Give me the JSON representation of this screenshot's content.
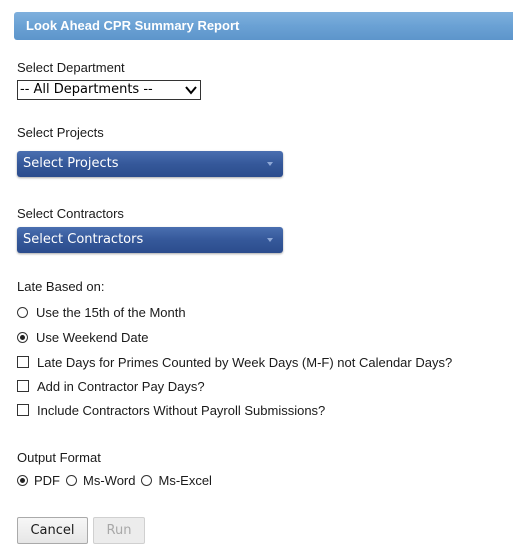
{
  "header": {
    "title": "Look Ahead CPR Summary Report"
  },
  "department": {
    "label": "Select Department",
    "selected": "-- All Departments --"
  },
  "projects": {
    "label": "Select Projects",
    "button_text": "Select Projects"
  },
  "contractors": {
    "label": "Select Contractors",
    "button_text": "Select Contractors"
  },
  "late_based": {
    "label": "Late Based on:",
    "options": [
      {
        "label": "Use the 15th of the Month",
        "selected": false
      },
      {
        "label": "Use Weekend Date",
        "selected": true
      }
    ]
  },
  "checkboxes": [
    {
      "label": "Late Days for Primes Counted by Week Days (M-F) not Calendar Days?",
      "checked": false
    },
    {
      "label": "Add in Contractor Pay Days?",
      "checked": false
    },
    {
      "label": "Include Contractors Without Payroll Submissions?",
      "checked": false
    }
  ],
  "output_format": {
    "label": "Output Format",
    "options": [
      {
        "label": "PDF",
        "selected": true
      },
      {
        "label": "Ms-Word",
        "selected": false
      },
      {
        "label": "Ms-Excel",
        "selected": false
      }
    ]
  },
  "buttons": {
    "cancel": "Cancel",
    "run": "Run"
  }
}
